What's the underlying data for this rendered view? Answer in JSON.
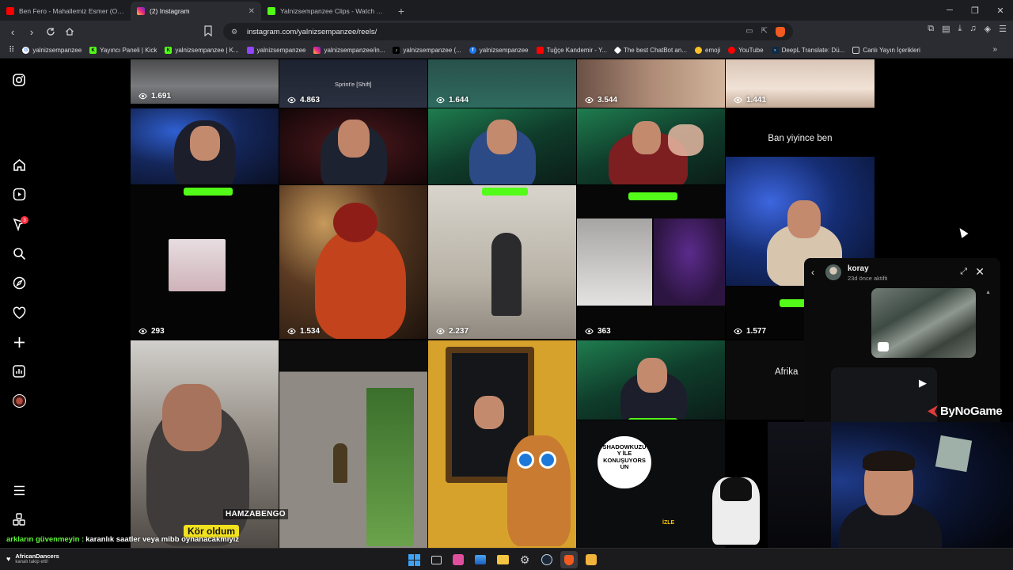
{
  "browser": {
    "tabs": [
      {
        "title": "Ben Fero - Mahallemiz Esmer (Offici...",
        "icon": "youtube-icon",
        "color": "#ff0000"
      },
      {
        "title": "(2) Instagram",
        "icon": "instagram-icon",
        "color": "#e1306c",
        "active": true
      },
      {
        "title": "Yalnizsempanzee Clips - Watch Live o...",
        "icon": "kick-icon",
        "color": "#53fc18"
      }
    ],
    "url": "instagram.com/yalnizsempanzee/reels/",
    "bookmarks": [
      {
        "label": "yalnizsempanzee",
        "icon": "google-icon",
        "color": "#ffffff"
      },
      {
        "label": "Yayıncı Paneli | Kick",
        "icon": "kick-icon",
        "color": "#53fc18"
      },
      {
        "label": "yalnizsempanzee | K...",
        "icon": "kick-icon",
        "color": "#53fc18"
      },
      {
        "label": "yalnizsempanzee",
        "icon": "twitch-icon",
        "color": "#9146ff"
      },
      {
        "label": "yalnizsempanzee/in...",
        "icon": "instagram-icon",
        "color": "#e1306c"
      },
      {
        "label": "yalnizsempanzee (...",
        "icon": "tiktok-icon",
        "color": "#ffffff"
      },
      {
        "label": "yalnizsempanzee",
        "icon": "facebook-icon",
        "color": "#1877f2"
      },
      {
        "label": "Tuğçe Kandemir - Y...",
        "icon": "youtube-icon",
        "color": "#ff0000"
      },
      {
        "label": "The best ChatBot an...",
        "icon": "chatbot-icon",
        "color": "#ffffff"
      },
      {
        "label": "emoji",
        "icon": "emoji-icon",
        "color": "#f7c325"
      },
      {
        "label": "YouTube",
        "icon": "youtube-icon",
        "color": "#ff0000"
      },
      {
        "label": "DeepL Translate: Dü...",
        "icon": "deepl-icon",
        "color": "#0f2b46"
      },
      {
        "label": "Canlı Yayın İçerikleri",
        "icon": "folder-icon",
        "color": "#cfcfcf"
      }
    ]
  },
  "instagram": {
    "notification_count": "3",
    "reels": [
      {
        "views": "1.691",
        "overlay": ""
      },
      {
        "views": "4.863",
        "overlay": "Sprint'e [Shift]"
      },
      {
        "views": "1.644",
        "overlay": ""
      },
      {
        "views": "3.544",
        "overlay": ""
      },
      {
        "views": "1.441",
        "overlay": ""
      },
      {
        "views": "",
        "overlay": ""
      },
      {
        "views": "",
        "overlay": ""
      },
      {
        "views": "",
        "overlay": ""
      },
      {
        "views": "",
        "overlay": ""
      },
      {
        "views": "",
        "overlay": "Ban yiyince ben"
      },
      {
        "views": "293",
        "overlay": ""
      },
      {
        "views": "1.534",
        "overlay": ""
      },
      {
        "views": "2.237",
        "overlay": ""
      },
      {
        "views": "363",
        "overlay": ""
      },
      {
        "views": "1.577",
        "overlay": ""
      },
      {
        "views": "",
        "overlay": ""
      },
      {
        "views": "",
        "overlay": ""
      },
      {
        "views": "",
        "overlay": ""
      },
      {
        "views": "",
        "overlay": ""
      },
      {
        "views": "",
        "overlay": "Afrika"
      }
    ],
    "dm": {
      "name": "koray",
      "status": "23d önce aktifti"
    }
  },
  "stream": {
    "logo": "ByNoGame",
    "chat_nick": "arkların güvenmeyin :",
    "chat_text": "karanlık saatler veya mibb oynanacakmıyız",
    "caption": "Kör oldum",
    "watermark": "HAMZABENGO",
    "bubble": "SHADOWKUZU Y İLE KONUŞUYORS UN",
    "izle": "İZLE"
  },
  "taskbar": {
    "user": "AfricanDancers",
    "subtitle": "kanalı takip etti!"
  }
}
